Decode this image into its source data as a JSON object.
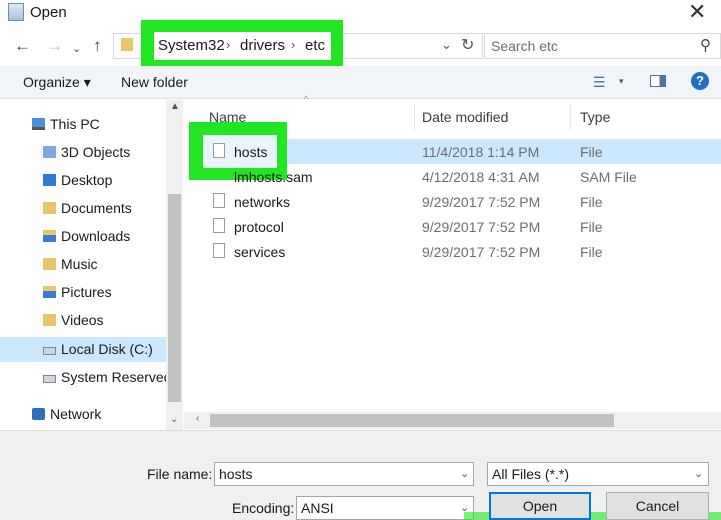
{
  "window": {
    "title": "Open",
    "close_glyph": "✕"
  },
  "address": {
    "crumbs": [
      "System32",
      "drivers",
      "etc"
    ],
    "separator": "›",
    "search_placeholder": "Search etc"
  },
  "toolbar": {
    "organize": "Organize ▾",
    "new_folder": "New folder"
  },
  "nav": {
    "items": [
      {
        "label": "This PC",
        "icon": "pc-icon"
      },
      {
        "label": "3D Objects",
        "icon": "3d-objects-icon"
      },
      {
        "label": "Desktop",
        "icon": "desktop-icon"
      },
      {
        "label": "Documents",
        "icon": "documents-icon"
      },
      {
        "label": "Downloads",
        "icon": "downloads-icon"
      },
      {
        "label": "Music",
        "icon": "music-icon"
      },
      {
        "label": "Pictures",
        "icon": "pictures-icon"
      },
      {
        "label": "Videos",
        "icon": "videos-icon"
      },
      {
        "label": "Local Disk (C:)",
        "icon": "drive-icon",
        "selected": true
      },
      {
        "label": "System Reserved",
        "icon": "drive-icon"
      },
      {
        "label": "Network",
        "icon": "network-icon"
      }
    ]
  },
  "list": {
    "columns": [
      "Name",
      "Date modified",
      "Type"
    ],
    "rows": [
      {
        "name": "hosts",
        "date": "11/4/2018 1:14 PM",
        "type": "File",
        "selected": true
      },
      {
        "name": "lmhosts.sam",
        "date": "4/12/2018 4:31 AM",
        "type": "SAM File"
      },
      {
        "name": "networks",
        "date": "9/29/2017 7:52 PM",
        "type": "File"
      },
      {
        "name": "protocol",
        "date": "9/29/2017 7:52 PM",
        "type": "File"
      },
      {
        "name": "services",
        "date": "9/29/2017 7:52 PM",
        "type": "File"
      }
    ]
  },
  "bottom": {
    "filename_label": "File name:",
    "filename_value": "hosts",
    "filter_value": "All Files  (*.*)",
    "encoding_label": "Encoding:",
    "encoding_value": "ANSI",
    "open_label": "Open",
    "cancel_label": "Cancel"
  },
  "colors": {
    "highlight": "#22e622",
    "selection": "#cce8ff",
    "accent": "#0078d7"
  }
}
